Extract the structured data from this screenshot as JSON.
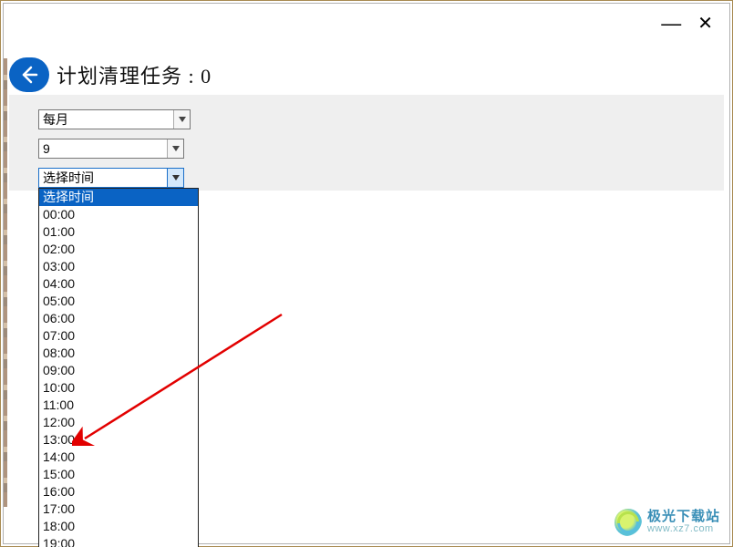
{
  "header": {
    "title": "计划清理任务 : 0"
  },
  "titlebar": {
    "minimize_label": "—",
    "close_label": "✕"
  },
  "combos": {
    "frequency": {
      "value": "每月"
    },
    "day": {
      "value": "9"
    },
    "time": {
      "value": "选择时间"
    }
  },
  "dropdown": {
    "options": [
      "选择时间",
      "00:00",
      "01:00",
      "02:00",
      "03:00",
      "04:00",
      "05:00",
      "06:00",
      "07:00",
      "08:00",
      "09:00",
      "10:00",
      "11:00",
      "12:00",
      "13:00",
      "14:00",
      "15:00",
      "16:00",
      "17:00",
      "18:00",
      "19:00"
    ],
    "selected_index": 0
  },
  "watermark": {
    "title": "极光下载站",
    "url": "www.xz7.com"
  }
}
